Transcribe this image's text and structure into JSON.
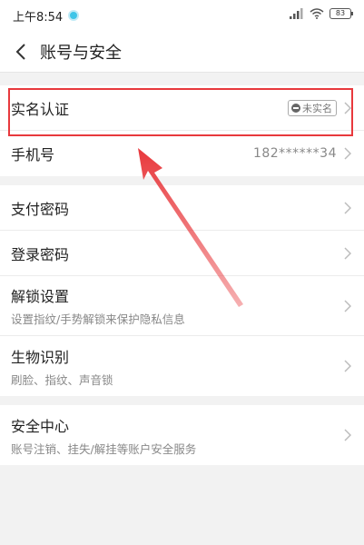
{
  "status_bar": {
    "time": "上午8:54",
    "battery": "83"
  },
  "nav": {
    "title": "账号与安全"
  },
  "group1": [
    {
      "label": "实名认证",
      "badge": "未实名"
    },
    {
      "label": "手机号",
      "value": "182******34"
    }
  ],
  "group2": [
    {
      "label": "支付密码"
    },
    {
      "label": "登录密码"
    },
    {
      "label": "解锁设置",
      "sub": "设置指纹/手势解锁来保护隐私信息"
    },
    {
      "label": "生物识别",
      "sub": "刷脸、指纹、声音锁"
    }
  ],
  "group3": [
    {
      "label": "安全中心",
      "sub": "账号注销、挂失/解挂等账户安全服务"
    }
  ],
  "annotation": {
    "color": "#e8393d"
  }
}
